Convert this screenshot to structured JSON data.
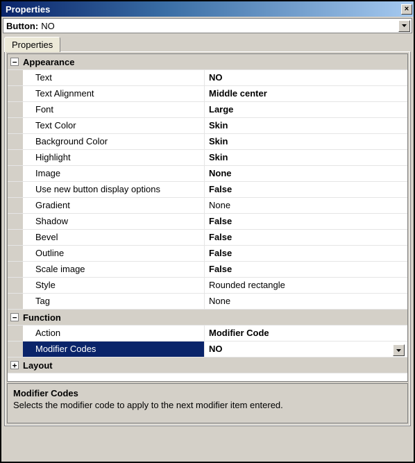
{
  "window": {
    "title": "Properties"
  },
  "selector": {
    "label": "Button:",
    "value": "NO"
  },
  "tabs": [
    {
      "label": "Properties"
    }
  ],
  "categories": [
    {
      "name": "Appearance",
      "expanded": true,
      "props": [
        {
          "name": "Text",
          "value": "NO",
          "bold": true
        },
        {
          "name": "Text Alignment",
          "value": "Middle center",
          "bold": true
        },
        {
          "name": "Font",
          "value": "Large",
          "bold": true
        },
        {
          "name": "Text Color",
          "value": "Skin",
          "bold": true
        },
        {
          "name": "Background Color",
          "value": "Skin",
          "bold": true
        },
        {
          "name": "Highlight",
          "value": "Skin",
          "bold": true
        },
        {
          "name": "Image",
          "value": "None",
          "bold": true
        },
        {
          "name": "Use new button display options",
          "value": "False",
          "bold": true
        },
        {
          "name": "Gradient",
          "value": "None",
          "bold": false
        },
        {
          "name": "Shadow",
          "value": "False",
          "bold": true
        },
        {
          "name": "Bevel",
          "value": "False",
          "bold": true
        },
        {
          "name": "Outline",
          "value": "False",
          "bold": true
        },
        {
          "name": "Scale image",
          "value": "False",
          "bold": true
        },
        {
          "name": "Style",
          "value": "Rounded rectangle",
          "bold": false
        },
        {
          "name": "Tag",
          "value": "None",
          "bold": false
        }
      ]
    },
    {
      "name": "Function",
      "expanded": true,
      "props": [
        {
          "name": "Action",
          "value": "Modifier Code",
          "bold": true
        },
        {
          "name": "Modifier Codes",
          "value": "NO",
          "bold": true,
          "selected": true,
          "dropdown": true
        }
      ]
    },
    {
      "name": "Layout",
      "expanded": false,
      "props": []
    }
  ],
  "description": {
    "title": "Modifier Codes",
    "text": "Selects the modifier code to apply to the next modifier item entered."
  },
  "glyphs": {
    "close": "×",
    "minus": "−",
    "plus": "+"
  }
}
